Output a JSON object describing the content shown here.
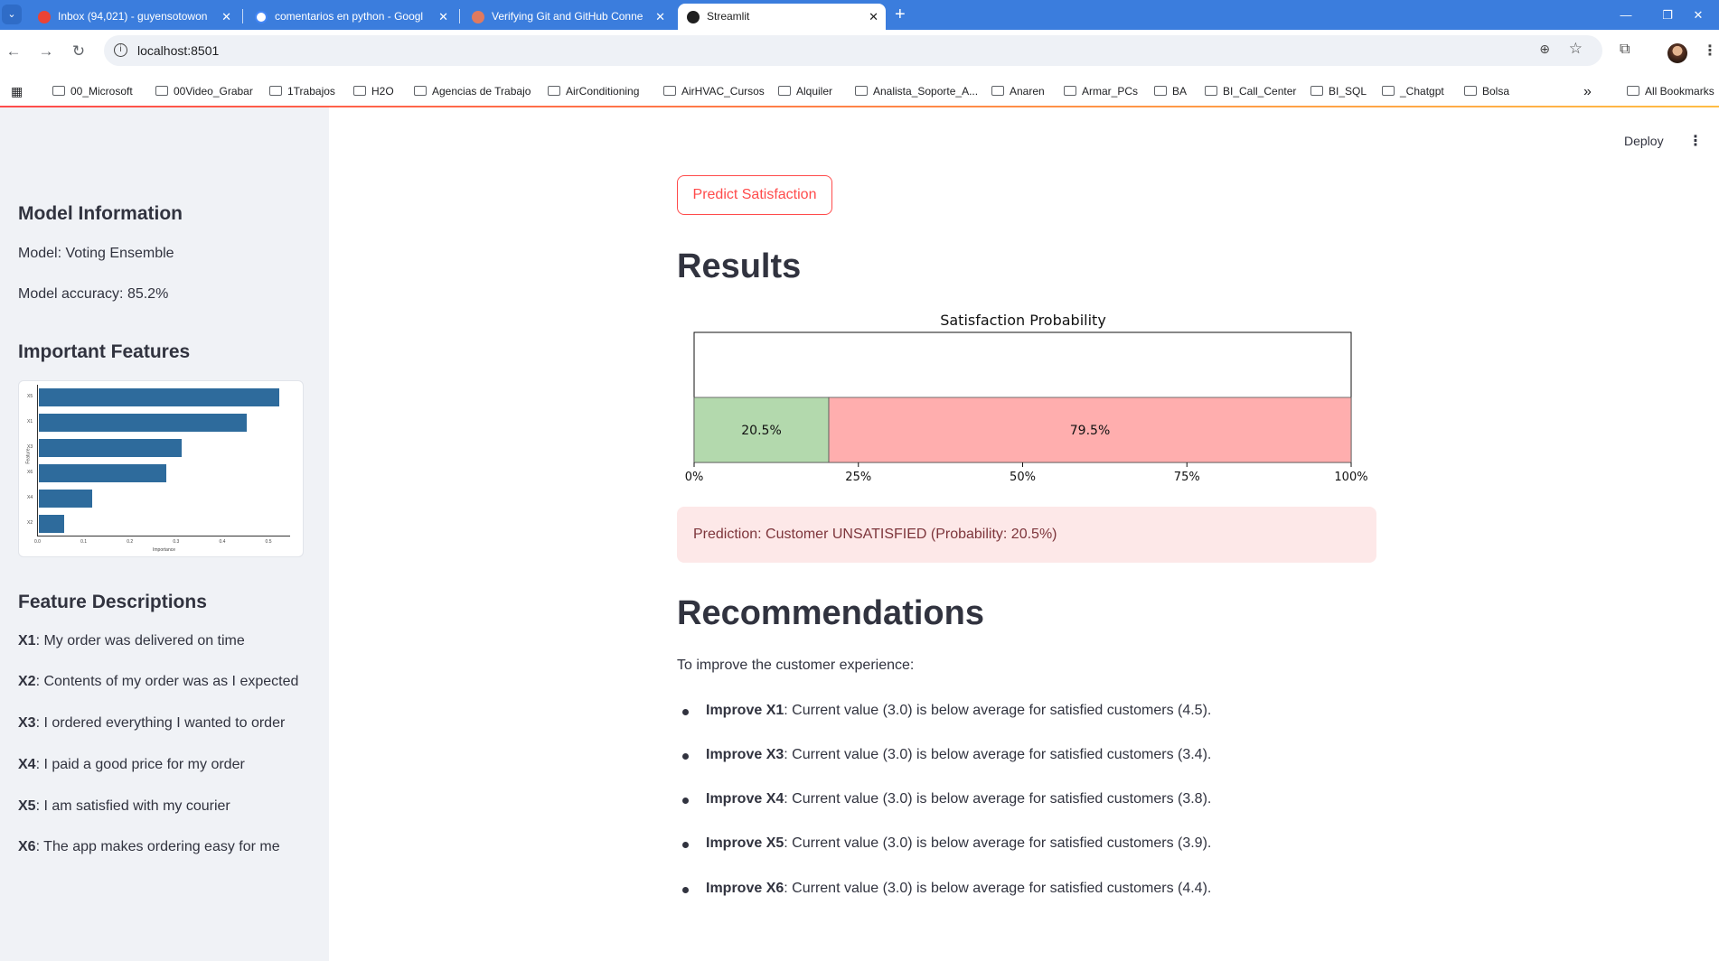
{
  "browser": {
    "tabs": [
      {
        "title": "Inbox (94,021) - guyensotowon",
        "active": false
      },
      {
        "title": "comentarios en python - Googl",
        "active": false
      },
      {
        "title": "Verifying Git and GitHub Conne",
        "active": false
      },
      {
        "title": "Streamlit",
        "active": true
      }
    ],
    "url": "localhost:8501",
    "bookmarks": [
      "00_Microsoft",
      "00Video_Grabar",
      "1Trabajos",
      "H2O",
      "Agencias de Trabajo",
      "AirConditioning",
      "AirHVAC_Cursos",
      "Alquiler",
      "Analista_Soporte_A...",
      "Anaren",
      "Armar_PCs",
      "BA",
      "BI_Call_Center",
      "BI_SQL",
      "_Chatgpt",
      "Bolsa"
    ],
    "all_bookmarks": "All Bookmarks",
    "overflow": "»"
  },
  "sidebar": {
    "model_heading": "Model Information",
    "model_line": "Model: Voting Ensemble",
    "accuracy_line": "Model accuracy: 85.2%",
    "features_heading": "Important Features",
    "descriptions_heading": "Feature Descriptions",
    "descriptions": [
      {
        "key": "X1",
        "text": ": My order was delivered on time"
      },
      {
        "key": "X2",
        "text": ": Contents of my order was as I expected"
      },
      {
        "key": "X3",
        "text": ": I ordered everything I wanted to order"
      },
      {
        "key": "X4",
        "text": ": I paid a good price for my order"
      },
      {
        "key": "X5",
        "text": ": I am satisfied with my courier"
      },
      {
        "key": "X6",
        "text": ": The app makes ordering easy for me"
      }
    ]
  },
  "importance_chart": {
    "ylabel": "Feature",
    "xlabel": "Importance",
    "features": [
      "X5",
      "X1",
      "X3",
      "X6",
      "X4",
      "X2"
    ],
    "values": [
      0.52,
      0.45,
      0.31,
      0.275,
      0.115,
      0.055
    ],
    "xticks": [
      "0.0",
      "0.1",
      "0.2",
      "0.3",
      "0.4",
      "0.5"
    ]
  },
  "main": {
    "deploy_label": "Deploy",
    "predict_button": "Predict Satisfaction",
    "results_heading": "Results",
    "recommendations_heading": "Recommendations",
    "prediction_text": "Prediction: Customer UNSATISFIED (Probability: 20.5%)",
    "intro_text": "To improve the customer experience:",
    "recommendations": [
      {
        "bold": "Improve X1",
        "text": ": Current value (3.0) is below average for satisfied customers (4.5)."
      },
      {
        "bold": "Improve X3",
        "text": ": Current value (3.0) is below average for satisfied customers (3.4)."
      },
      {
        "bold": "Improve X4",
        "text": ": Current value (3.0) is below average for satisfied customers (3.8)."
      },
      {
        "bold": "Improve X5",
        "text": ": Current value (3.0) is below average for satisfied customers (3.9)."
      },
      {
        "bold": "Improve X6",
        "text": ": Current value (3.0) is below average for satisfied customers (4.4)."
      }
    ]
  },
  "chart_data": {
    "type": "bar",
    "title": "Satisfaction Probability",
    "orientation": "horizontal-stacked",
    "series": [
      {
        "value": 20.5,
        "label": "20.5%",
        "color": "#b3d9ad"
      },
      {
        "value": 79.5,
        "label": "79.5%",
        "color": "#ffaeae"
      }
    ],
    "xlim": [
      0,
      100
    ],
    "xticks": [
      "0%",
      "25%",
      "50%",
      "75%",
      "100%"
    ]
  }
}
